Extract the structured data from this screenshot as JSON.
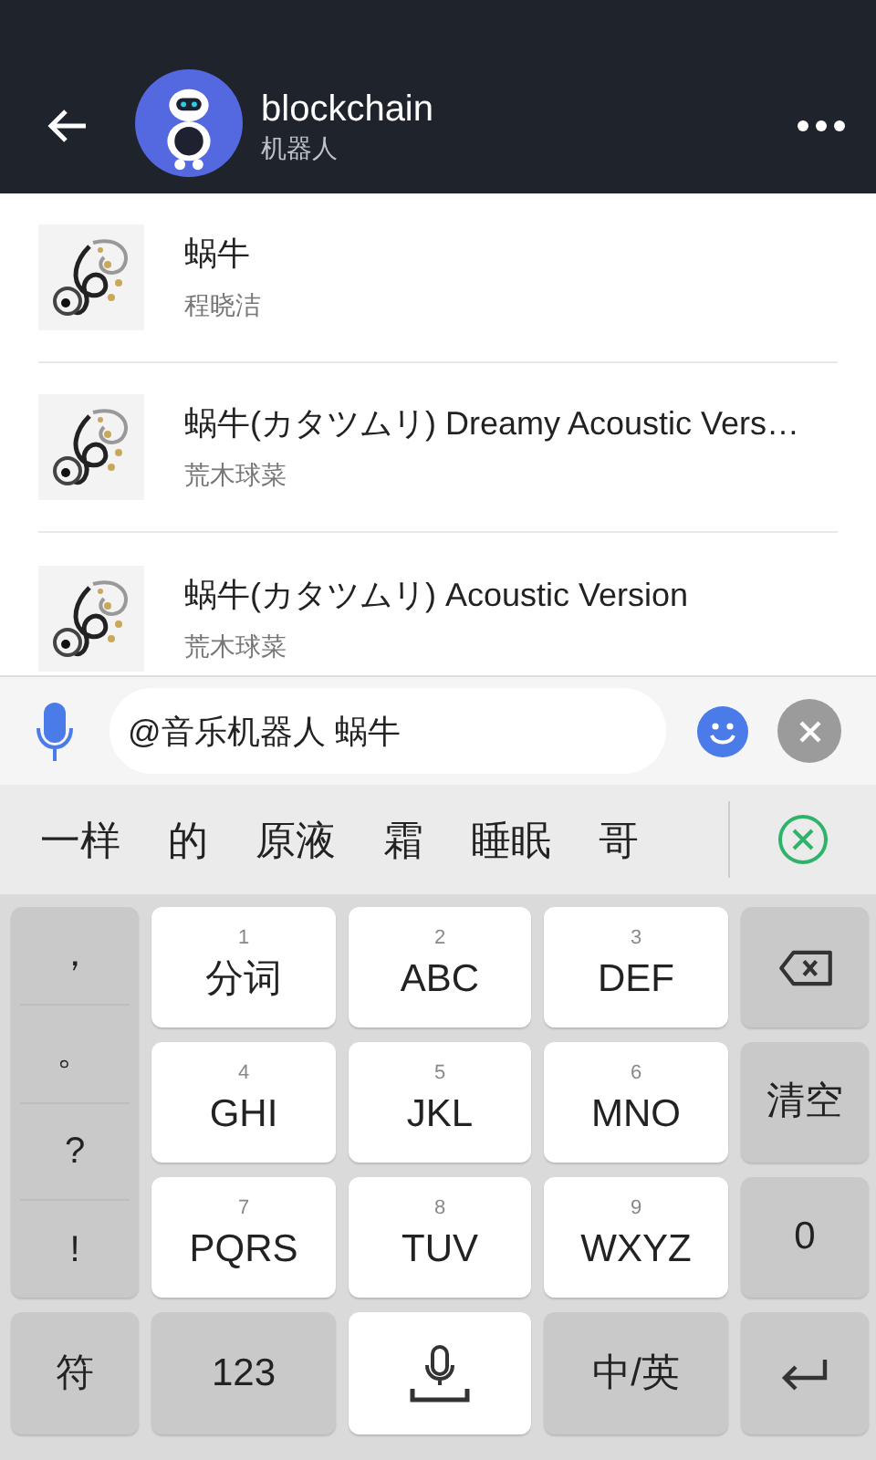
{
  "header": {
    "title": "blockchain",
    "subtitle": "机器人"
  },
  "songs": [
    {
      "title": "蜗牛",
      "artist": "程晓洁"
    },
    {
      "title": "蜗牛(カタツムリ) Dreamy Acoustic Vers…",
      "artist": "荒木球菜"
    },
    {
      "title": "蜗牛(カタツムリ) Acoustic Version",
      "artist": "荒木球菜"
    }
  ],
  "input": {
    "value": "@音乐机器人 蜗牛"
  },
  "candidates": [
    "一样",
    "的",
    "原液",
    "霜",
    "睡眠",
    "哥"
  ],
  "keyboard": {
    "symbols": [
      "，",
      "。",
      "?",
      "!"
    ],
    "keys": [
      {
        "kind": "letter",
        "digit": "1",
        "label": "分词"
      },
      {
        "kind": "letter",
        "digit": "2",
        "label": "ABC"
      },
      {
        "kind": "letter",
        "digit": "3",
        "label": "DEF"
      },
      {
        "kind": "backspace"
      },
      {
        "kind": "letter",
        "digit": "4",
        "label": "GHI"
      },
      {
        "kind": "letter",
        "digit": "5",
        "label": "JKL"
      },
      {
        "kind": "letter",
        "digit": "6",
        "label": "MNO"
      },
      {
        "kind": "func",
        "label": "清空"
      },
      {
        "kind": "letter",
        "digit": "7",
        "label": "PQRS"
      },
      {
        "kind": "letter",
        "digit": "8",
        "label": "TUV"
      },
      {
        "kind": "letter",
        "digit": "9",
        "label": "WXYZ"
      },
      {
        "kind": "func",
        "label": "0"
      }
    ],
    "bottom": [
      {
        "kind": "func",
        "label": "符"
      },
      {
        "kind": "func",
        "label": "123"
      },
      {
        "kind": "space"
      },
      {
        "kind": "func",
        "label": "中/英"
      },
      {
        "kind": "enter"
      }
    ]
  }
}
